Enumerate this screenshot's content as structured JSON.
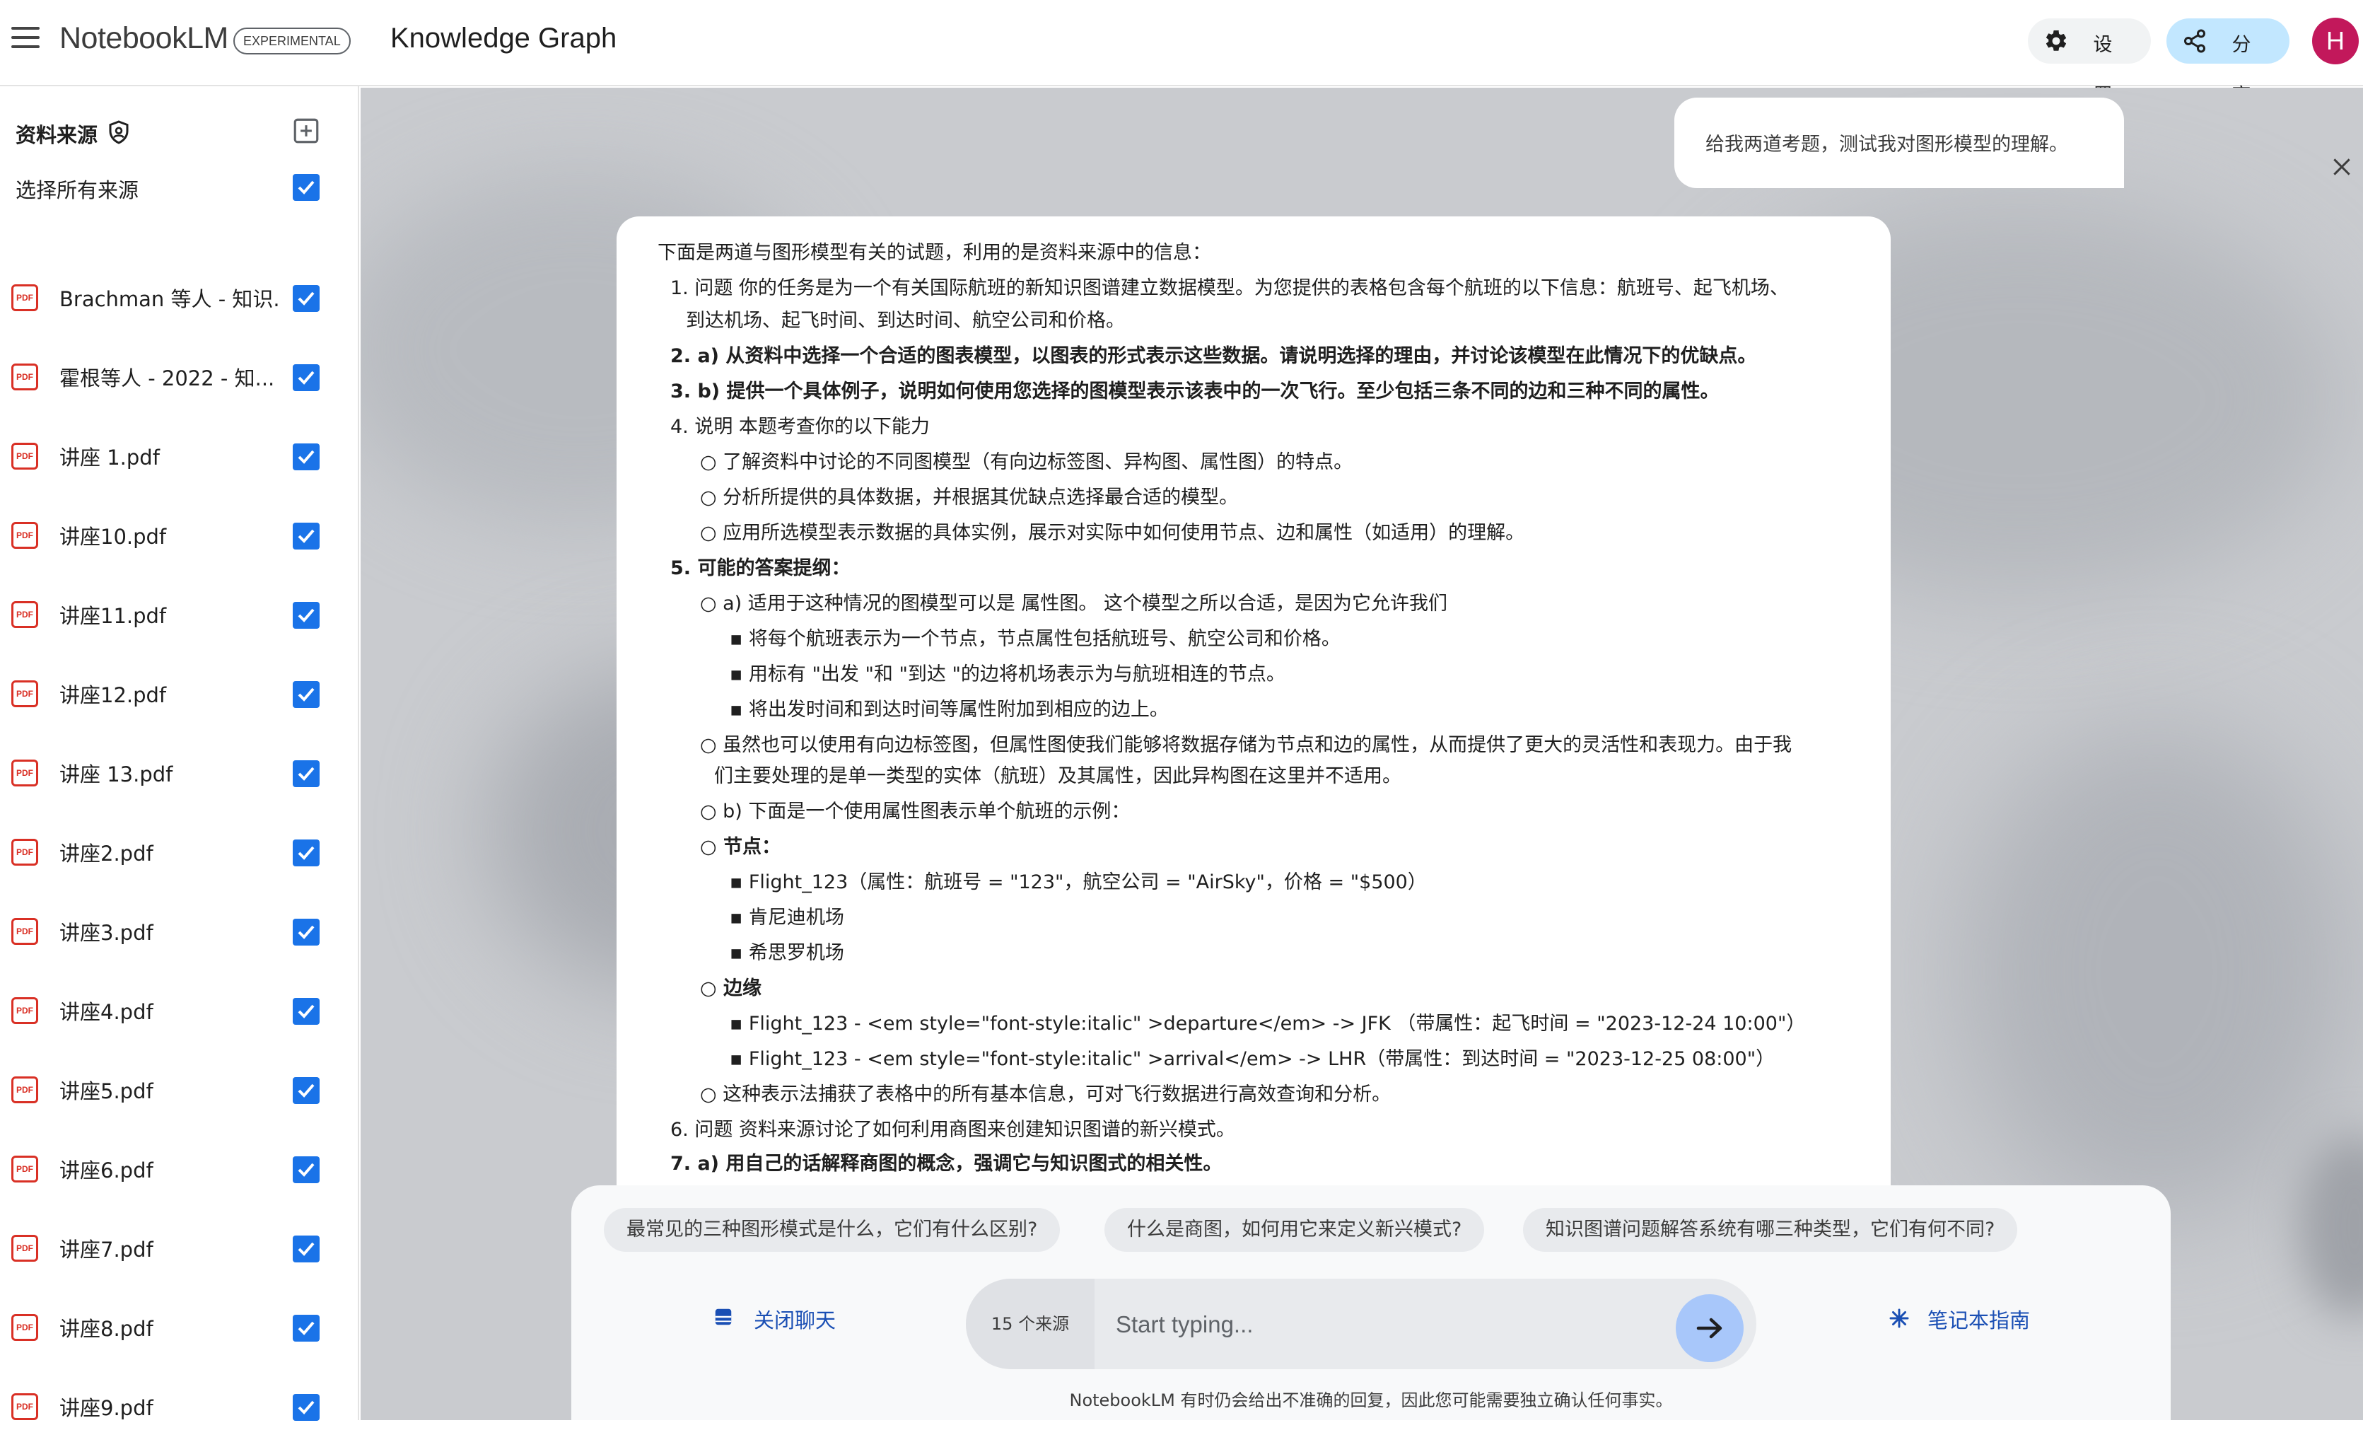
{
  "header": {
    "brand": "NotebookLM",
    "badge": "EXPERIMENTAL",
    "title": "Knowledge Graph",
    "settings_label": "设置",
    "share_label": "分享",
    "avatar_initial": "H"
  },
  "sidebar": {
    "heading": "资料来源",
    "select_all": "选择所有来源",
    "sources": [
      {
        "label": "Brachman 等人 - 知识...",
        "icon": "PDF"
      },
      {
        "label": "霍根等人 - 2022 - 知...",
        "icon": "PDF"
      },
      {
        "label": "讲座 1.pdf",
        "icon": "PDF"
      },
      {
        "label": "讲座10.pdf",
        "icon": "PDF"
      },
      {
        "label": "讲座11.pdf",
        "icon": "PDF"
      },
      {
        "label": "讲座12.pdf",
        "icon": "PDF"
      },
      {
        "label": "讲座 13.pdf",
        "icon": "PDF"
      },
      {
        "label": "讲座2.pdf",
        "icon": "PDF"
      },
      {
        "label": "讲座3.pdf",
        "icon": "PDF"
      },
      {
        "label": "讲座4.pdf",
        "icon": "PDF"
      },
      {
        "label": "讲座5.pdf",
        "icon": "PDF"
      },
      {
        "label": "讲座6.pdf",
        "icon": "PDF"
      },
      {
        "label": "讲座7.pdf",
        "icon": "PDF"
      },
      {
        "label": "讲座8.pdf",
        "icon": "PDF"
      },
      {
        "label": "讲座9.pdf",
        "icon": "PDF"
      }
    ]
  },
  "chat": {
    "user_message": "给我两道考题，测试我对图形模型的理解。",
    "response_lines": [
      "下面是两道与图形模型有关的试题，利用的是资料来源中的信息：",
      "1. 问题 你的任务是为一个有关国际航班的新知识图谱建立数据模型。为您提供的表格包含每个航班的以下信息：航班号、起飞机场、",
      "到达机场、起飞时间、到达时间、航空公司和价格。",
      "2. a) 从资料中选择一个合适的图表模型，以图表的形式表示这些数据。请说明选择的理由，并讨论该模型在此情况下的优缺点。",
      "3. b) 提供一个具体例子，说明如何使用您选择的图模型表示该表中的一次飞行。至少包括三条不同的边和三种不同的属性。",
      "4. 说明 本题考查你的以下能力",
      "○ 了解资料中讨论的不同图模型（有向边标签图、异构图、属性图）的特点。",
      "○ 分析所提供的具体数据，并根据其优缺点选择最合适的模型。",
      "○ 应用所选模型表示数据的具体实例，展示对实际中如何使用节点、边和属性（如适用）的理解。",
      "5.  可能的答案提纲：",
      "○ a) 适用于这种情况的图模型可以是 属性图。 这个模型之所以合适，是因为它允许我们",
      "▪ 将每个航班表示为一个节点，节点属性包括航班号、航空公司和价格。",
      "▪ 用标有 \"出发 \"和 \"到达 \"的边将机场表示为与航班相连的节点。",
      "▪ 将出发时间和到达时间等属性附加到相应的边上。",
      "○ 虽然也可以使用有向边标签图，但属性图使我们能够将数据存储为节点和边的属性，从而提供了更大的灵活性和表现力。由于我",
      "们主要处理的是单一类型的实体（航班）及其属性，因此异构图在这里并不适用。",
      "○ b) 下面是一个使用属性图表示单个航班的示例：",
      "○  节点：",
      "▪ Flight_123（属性：航班号 = \"123\"，航空公司 = \"AirSky\"，价格 = \"$500）",
      "▪ 肯尼迪机场",
      "▪ 希思罗机场",
      "○  边缘",
      "▪ Flight_123 - <em style=\"font-style:italic\" >departure</em> -> JFK （带属性：起飞时间 = \"2023-12-24 10:00\"）",
      "▪ Flight_123 - <em style=\"font-style:italic\" >arrival</em> -> LHR（带属性：到达时间 = \"2023-12-25 08:00\"）",
      "○ 这种表示法捕获了表格中的所有基本信息，可对飞行数据进行高效查询和分析。",
      "6. 问题 资料来源讨论了如何利用商图来创建知识图谱的新兴模式。",
      "7. a) 用自己的话解释商图的概念，强调它与知识图式的相关性。"
    ],
    "suggestions": [
      "最常见的三种图形模式是什么，它们有什么区别?",
      "什么是商图，如何用它来定义新兴模式?",
      "知识图谱问题解答系统有哪三种类型，它们有何不同?"
    ],
    "close_chat": "关闭聊天",
    "source_count": "15 个来源",
    "input_placeholder": "Start typing...",
    "guide": "笔记本指南",
    "disclaimer": "NotebookLM 有时仍会给出不准确的回复，因此您可能需要独立确认任何事实。"
  },
  "colors": {
    "accent_blue": "#1a73e8",
    "link_blue": "#1a4fb4",
    "share_bg": "#c2e7ff",
    "avatar_bg": "#c2185b",
    "pdf_red": "#d93025"
  }
}
